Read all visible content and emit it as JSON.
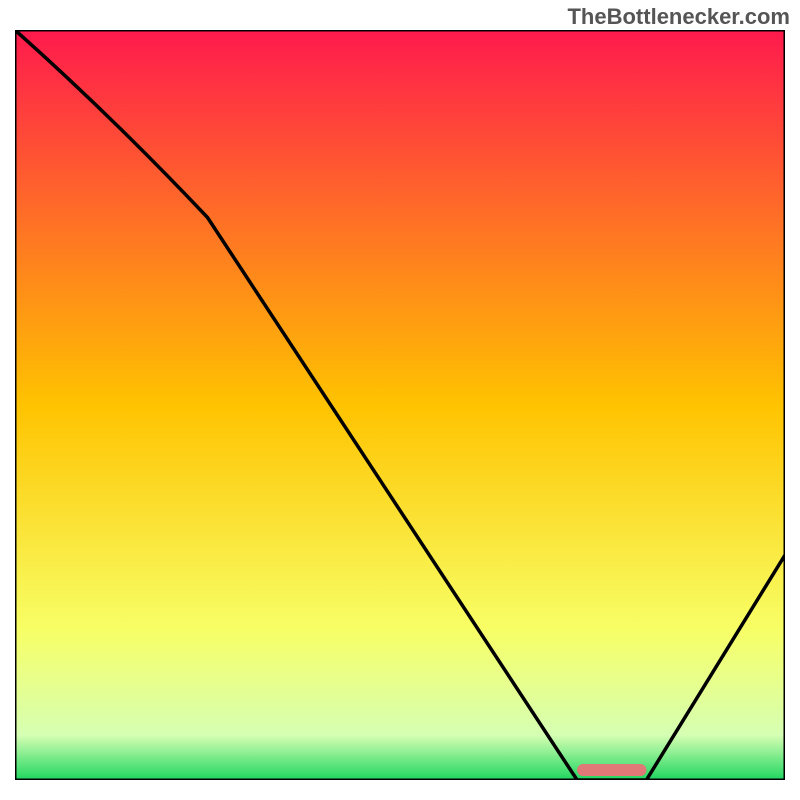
{
  "watermark": "TheBottlenecker.com",
  "chart_data": {
    "type": "line",
    "title": "",
    "xlabel": "",
    "ylabel": "",
    "xlim": [
      0,
      100
    ],
    "ylim": [
      0,
      100
    ],
    "x": [
      0,
      25,
      73,
      82,
      100
    ],
    "values": [
      100,
      75,
      0,
      0,
      30
    ],
    "highlight": {
      "x_start": 73,
      "x_end": 82,
      "color": "#e07878"
    },
    "gradient_stops": [
      {
        "offset": 0,
        "color": "#ff1a4d"
      },
      {
        "offset": 50,
        "color": "#ffc300"
      },
      {
        "offset": 80,
        "color": "#f7ff66"
      },
      {
        "offset": 95,
        "color": "#d6ffb3"
      },
      {
        "offset": 100,
        "color": "#1fd65f"
      }
    ]
  }
}
